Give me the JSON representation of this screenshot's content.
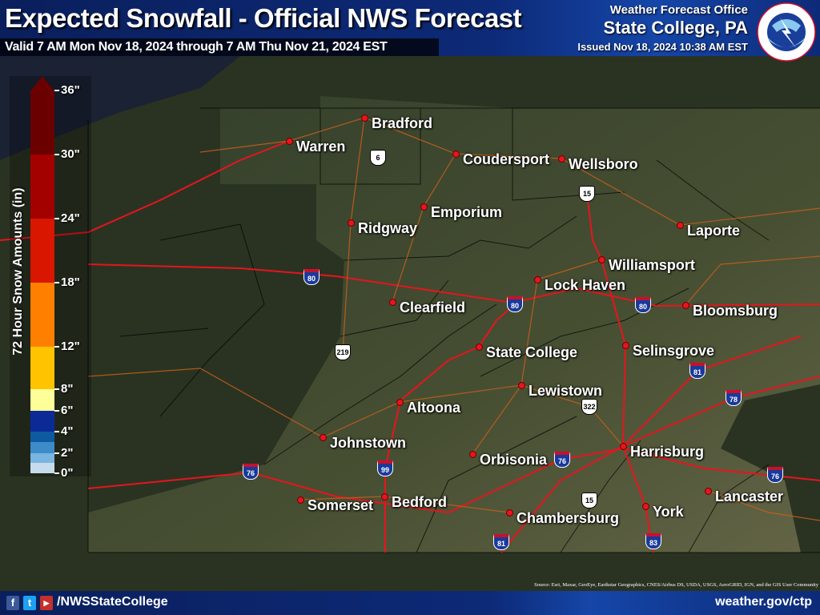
{
  "header": {
    "title": "Expected Snowfall - Official NWS Forecast",
    "valid": "Valid 7 AM Mon Nov 18, 2024 through 7 AM Thu Nov 21, 2024 EST",
    "office_line1": "Weather Forecast Office",
    "office_line2": "State College, PA",
    "issued": "Issued Nov 18, 2024 10:38 AM EST",
    "logo_text": "NATIONAL WEATHER SERVICE"
  },
  "legend": {
    "title": "72 Hour Snow Amounts (in)",
    "ticks": [
      "36\"",
      "30\"",
      "24\"",
      "18\"",
      "12\"",
      "8\"",
      "6\"",
      "4\"",
      "2\"",
      "0\""
    ],
    "bins": [
      {
        "range": "30-36+",
        "color": "#6b0000"
      },
      {
        "range": "24-30",
        "color": "#a30000"
      },
      {
        "range": "18-24",
        "color": "#d91600"
      },
      {
        "range": "12-18",
        "color": "#ff8000"
      },
      {
        "range": "8-12",
        "color": "#ffc300"
      },
      {
        "range": "6-8",
        "color": "#ffff99"
      },
      {
        "range": "4-6",
        "color": "#0c2a96"
      },
      {
        "range": "3-4",
        "color": "#0d5aa0"
      },
      {
        "range": "2-3",
        "color": "#3d8bc9"
      },
      {
        "range": "1-2",
        "color": "#7ab4e0"
      },
      {
        "range": "0-1",
        "color": "#c6dcec"
      }
    ]
  },
  "cities": [
    "Warren",
    "Bradford",
    "Coudersport",
    "Wellsboro",
    "Emporium",
    "Ridgway",
    "Laporte",
    "Williamsport",
    "Lock Haven",
    "Clearfield",
    "Bloomsburg",
    "State College",
    "Selinsgrove",
    "Lewistown",
    "Altoona",
    "Johnstown",
    "Harrisburg",
    "Orbisonia",
    "Lancaster",
    "Somerset",
    "Bedford",
    "York",
    "Chambersburg"
  ],
  "highways": [
    {
      "type": "US",
      "num": "6"
    },
    {
      "type": "US",
      "num": "15"
    },
    {
      "type": "I",
      "num": "80"
    },
    {
      "type": "I",
      "num": "80"
    },
    {
      "type": "I",
      "num": "80"
    },
    {
      "type": "US",
      "num": "219"
    },
    {
      "type": "I",
      "num": "81"
    },
    {
      "type": "I",
      "num": "78"
    },
    {
      "type": "US",
      "num": "322"
    },
    {
      "type": "I",
      "num": "76"
    },
    {
      "type": "I",
      "num": "99"
    },
    {
      "type": "I",
      "num": "76"
    },
    {
      "type": "I",
      "num": "76"
    },
    {
      "type": "US",
      "num": "15"
    },
    {
      "type": "I",
      "num": "81"
    },
    {
      "type": "I",
      "num": "83"
    }
  ],
  "map_snow_shading": "none visible",
  "footer": {
    "social": [
      "f",
      "t",
      "▶"
    ],
    "handle": "/NWSStateCollege",
    "site": "weather.gov/ctp",
    "source": "Source: Esri, Maxar, GeoEye, Earthstar Geographics, CNES/Airbus DS, USDA, USGS, AeroGRID, IGN, and the GIS User Community"
  }
}
